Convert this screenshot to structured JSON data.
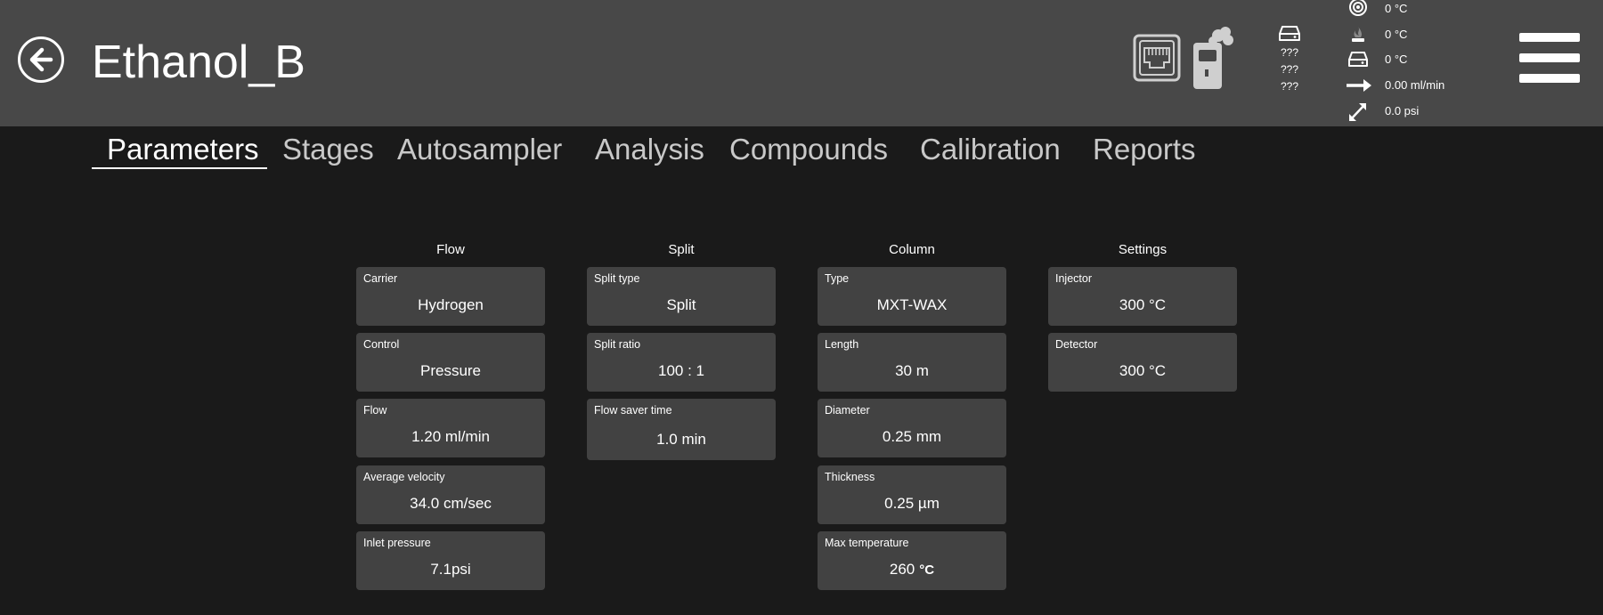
{
  "header": {
    "title": "Ethanol_B",
    "unknowns": [
      "???",
      "???",
      "???"
    ],
    "status": [
      {
        "icon": "target-icon",
        "value": "0 °C"
      },
      {
        "icon": "flame-icon",
        "value": "0 °C"
      },
      {
        "icon": "drive-icon",
        "value": "0 °C"
      },
      {
        "icon": "arrow-right-icon",
        "value": "0.00 ml/min"
      },
      {
        "icon": "expand-arrows-icon",
        "value": "0.0  psi"
      }
    ]
  },
  "tabs": [
    "Parameters",
    "Stages",
    "Autosampler",
    "Analysis",
    "Compounds",
    "Calibration",
    "Reports"
  ],
  "active_tab": "Parameters",
  "sections": {
    "flow": {
      "title": "Flow",
      "cards": [
        {
          "label": "Carrier",
          "value": "Hydrogen"
        },
        {
          "label": "Control",
          "value": "Pressure"
        },
        {
          "label": "Flow",
          "value": "1.20 ml/min"
        },
        {
          "label": "Average velocity",
          "value": "34.0 cm/sec"
        },
        {
          "label": "Inlet pressure",
          "value": "7.1psi"
        }
      ]
    },
    "split": {
      "title": "Split",
      "cards": [
        {
          "label": "Split type",
          "value": "Split"
        },
        {
          "label": "Split ratio",
          "value": "100 : 1"
        },
        {
          "label": "Flow saver time",
          "value": "1.0 min"
        }
      ]
    },
    "column": {
      "title": "Column",
      "cards": [
        {
          "label": "Type",
          "value": "MXT-WAX"
        },
        {
          "label": "Length",
          "value": "30 m"
        },
        {
          "label": "Diameter",
          "value": "0.25 mm"
        },
        {
          "label": "Thickness",
          "value": "0.25 µm"
        },
        {
          "label": "Max temperature",
          "value": "260",
          "unit": "°C"
        }
      ]
    },
    "settings": {
      "title": "Settings",
      "cards": [
        {
          "label": "Injector",
          "value": "300 °C"
        },
        {
          "label": "Detector",
          "value": "300 °C"
        }
      ]
    }
  },
  "colors": {
    "header_bg": "#484848",
    "page_bg": "#1a1a1a",
    "card_bg": "#424242",
    "tab_inactive": "#c8c8c8"
  }
}
